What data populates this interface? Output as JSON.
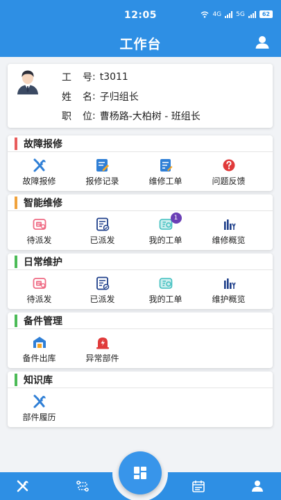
{
  "status_bar": {
    "time": "12:05",
    "network_1": "4G",
    "network_2": "5G",
    "battery": "62"
  },
  "header": {
    "title": "工作台",
    "user_icon": "user-icon"
  },
  "profile": {
    "avatar_icon": "avatar-icon",
    "rows": [
      {
        "label_a": "工",
        "label_b": "号",
        "value": "t3011"
      },
      {
        "label_a": "姓",
        "label_b": "名",
        "value": "子归组长"
      },
      {
        "label_a": "职",
        "label_b": "位",
        "value": "曹杨路-大柏树 - 班组长"
      }
    ]
  },
  "sections": [
    {
      "title": "故障报修",
      "accent": "#e85d5d",
      "items": [
        {
          "label": "故障报修",
          "icon": "wrench-screwdriver-icon"
        },
        {
          "label": "报修记录",
          "icon": "edit-record-icon"
        },
        {
          "label": "维修工单",
          "icon": "work-order-icon"
        },
        {
          "label": "问题反馈",
          "icon": "question-icon"
        }
      ]
    },
    {
      "title": "智能维修",
      "accent": "#f0a23c",
      "items": [
        {
          "label": "待派发",
          "icon": "pending-dispatch-icon"
        },
        {
          "label": "已派发",
          "icon": "dispatched-icon"
        },
        {
          "label": "我的工单",
          "icon": "my-orders-icon",
          "badge": "1"
        },
        {
          "label": "维修概览",
          "icon": "bar-chart-icon"
        }
      ]
    },
    {
      "title": "日常维护",
      "accent": "#4cbb57",
      "items": [
        {
          "label": "待派发",
          "icon": "pending-dispatch-icon"
        },
        {
          "label": "已派发",
          "icon": "dispatched-icon"
        },
        {
          "label": "我的工单",
          "icon": "my-orders-icon"
        },
        {
          "label": "维护概览",
          "icon": "bar-chart-icon"
        }
      ]
    },
    {
      "title": "备件管理",
      "accent": "#4cbb57",
      "items": [
        {
          "label": "备件出库",
          "icon": "warehouse-icon"
        },
        {
          "label": "异常部件",
          "icon": "alarm-icon"
        }
      ]
    },
    {
      "title": "知识库",
      "accent": "#4cbb57",
      "items": [
        {
          "label": "部件履历",
          "icon": "wrench-screwdriver-icon"
        }
      ]
    }
  ],
  "bottom_nav": {
    "items": [
      {
        "name": "tools-icon"
      },
      {
        "name": "route-icon"
      },
      {
        "name": "dashboard-icon"
      },
      {
        "name": "calendar-icon"
      },
      {
        "name": "profile-icon"
      }
    ]
  },
  "colors": {
    "primary": "#2e8fe4",
    "icon_blue": "#2f7fd6",
    "icon_pink": "#ef6b84",
    "icon_teal": "#3fbfbf",
    "icon_navy": "#1e3f8a",
    "icon_red": "#e03a3a"
  }
}
